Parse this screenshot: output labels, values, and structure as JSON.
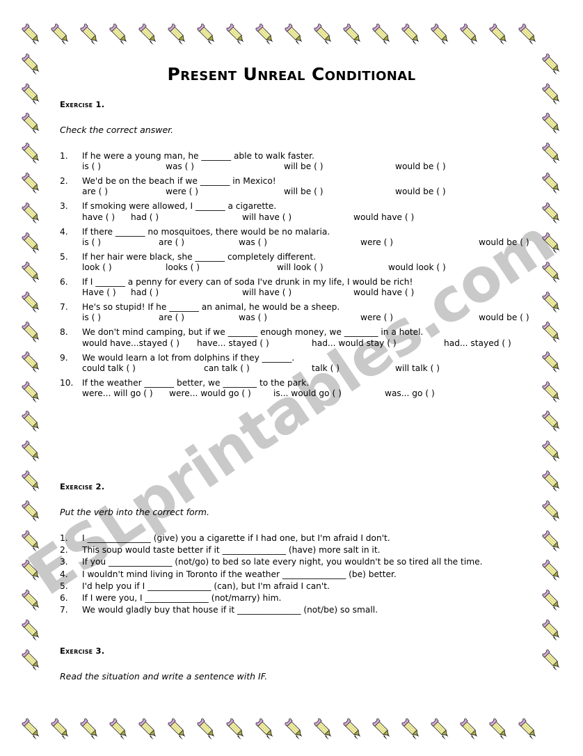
{
  "document": {
    "title": "Present Unreal Conditional",
    "watermark": "ESLprintables.com",
    "border_icon": "pencil-icon",
    "colors": {
      "text": "#000000",
      "watermark": "#c9c9c9",
      "pencil_eraser": "#d9a9e0",
      "pencil_ferrule": "#c0bcc0",
      "pencil_body": "#f2f0a8",
      "pencil_wood": "#a8a840",
      "pencil_lead": "#1a1a1a",
      "page_background": "#ffffff"
    }
  },
  "exercise1": {
    "heading": "Exercise 1.",
    "instruction": "Check the correct answer.",
    "questions": [
      {
        "number": "1.",
        "text": "If he were a young man, he _______ able to walk faster.",
        "options": [
          "is (  )",
          "was (  )",
          "will be (  )",
          "would be (  )"
        ],
        "offsets": [
          0,
          120,
          290,
          450
        ]
      },
      {
        "number": "2.",
        "text": "We'd be on the beach if we _______ in Mexico!",
        "options": [
          "are (  )",
          "were (  )",
          "will be (  )",
          "would be (  )"
        ],
        "offsets": [
          0,
          120,
          290,
          450
        ]
      },
      {
        "number": "3.",
        "text": "If smoking were allowed, I _______ a cigarette.",
        "options": [
          "have (  )",
          "had (  )",
          "will have (  )",
          "would have (  )"
        ],
        "offsets": [
          0,
          70,
          230,
          390
        ]
      },
      {
        "number": "4.",
        "text": "If there _______ no mosquitoes, there would be no malaria.",
        "options": [
          "is (  )",
          "are (  )",
          "was (  )",
          "were (  )",
          "would be (  )"
        ],
        "offsets": [
          0,
          110,
          225,
          400,
          570
        ]
      },
      {
        "number": "5.",
        "text": "If her hair were black, she _______ completely different.",
        "options": [
          "look (  )",
          "looks (  )",
          "will look (  )",
          "would look (  )"
        ],
        "offsets": [
          0,
          120,
          280,
          440
        ]
      },
      {
        "number": "6.",
        "text": "If I _______ a penny for every can of soda I've drunk in my life, I would be rich!",
        "options": [
          "Have (  )",
          "had (  )",
          "will have (  )",
          "would have (  )"
        ],
        "offsets": [
          0,
          70,
          230,
          390
        ]
      },
      {
        "number": "7.",
        "text": "He's so stupid! If he _______ an animal, he would be a sheep.",
        "options": [
          "is (  )",
          "are (  )",
          "was (  )",
          "were (  )",
          "would be (  )"
        ],
        "offsets": [
          0,
          110,
          225,
          400,
          570
        ]
      },
      {
        "number": "8.",
        "text": "We don't mind camping, but if we _______ enough money, we ________ in a hotel.",
        "options": [
          "would have...stayed (  )",
          "have... stayed (  )",
          "had... would stay (  )",
          "had... stayed (  )"
        ],
        "offsets": [
          0,
          165,
          330,
          520
        ]
      },
      {
        "number": "9.",
        "text": "We would learn a lot from dolphins if they _______.",
        "options": [
          "could talk (  )",
          "can talk (  )",
          "talk (  )",
          "will talk (  )"
        ],
        "offsets": [
          0,
          175,
          330,
          450
        ]
      },
      {
        "number": "10.",
        "text": "If the weather _______ better, we ________ to the park.",
        "options": [
          "were... will go (  )",
          "were... would go (  )",
          "is... would go (  )",
          "was... go (  )"
        ],
        "offsets": [
          0,
          125,
          275,
          435
        ]
      }
    ]
  },
  "exercise2": {
    "heading": "Exercise 2.",
    "instruction": "Put the verb into the correct form.",
    "questions": [
      {
        "number": "1.",
        "text": "I _______________ (give) you a cigarette if I had one, but I'm afraid I don't."
      },
      {
        "number": "2.",
        "text": "This soup would taste better if it _______________ (have) more salt in it."
      },
      {
        "number": "3.",
        "text": "If you _______________ (not/go) to bed so late every night, you wouldn't be so tired all the time."
      },
      {
        "number": "4.",
        "text": "I wouldn't mind living in Toronto if the weather _______________ (be) better."
      },
      {
        "number": "5.",
        "text": "I'd help you if I _______________ (can), but I'm afraid I can't."
      },
      {
        "number": "6.",
        "text": "If I were you, I _______________ (not/marry) him."
      },
      {
        "number": "7.",
        "text": "We would gladly buy that house if it _______________ (not/be) so small."
      }
    ]
  },
  "exercise3": {
    "heading": "Exercise 3.",
    "instruction": "Read the situation and write a sentence with IF."
  }
}
